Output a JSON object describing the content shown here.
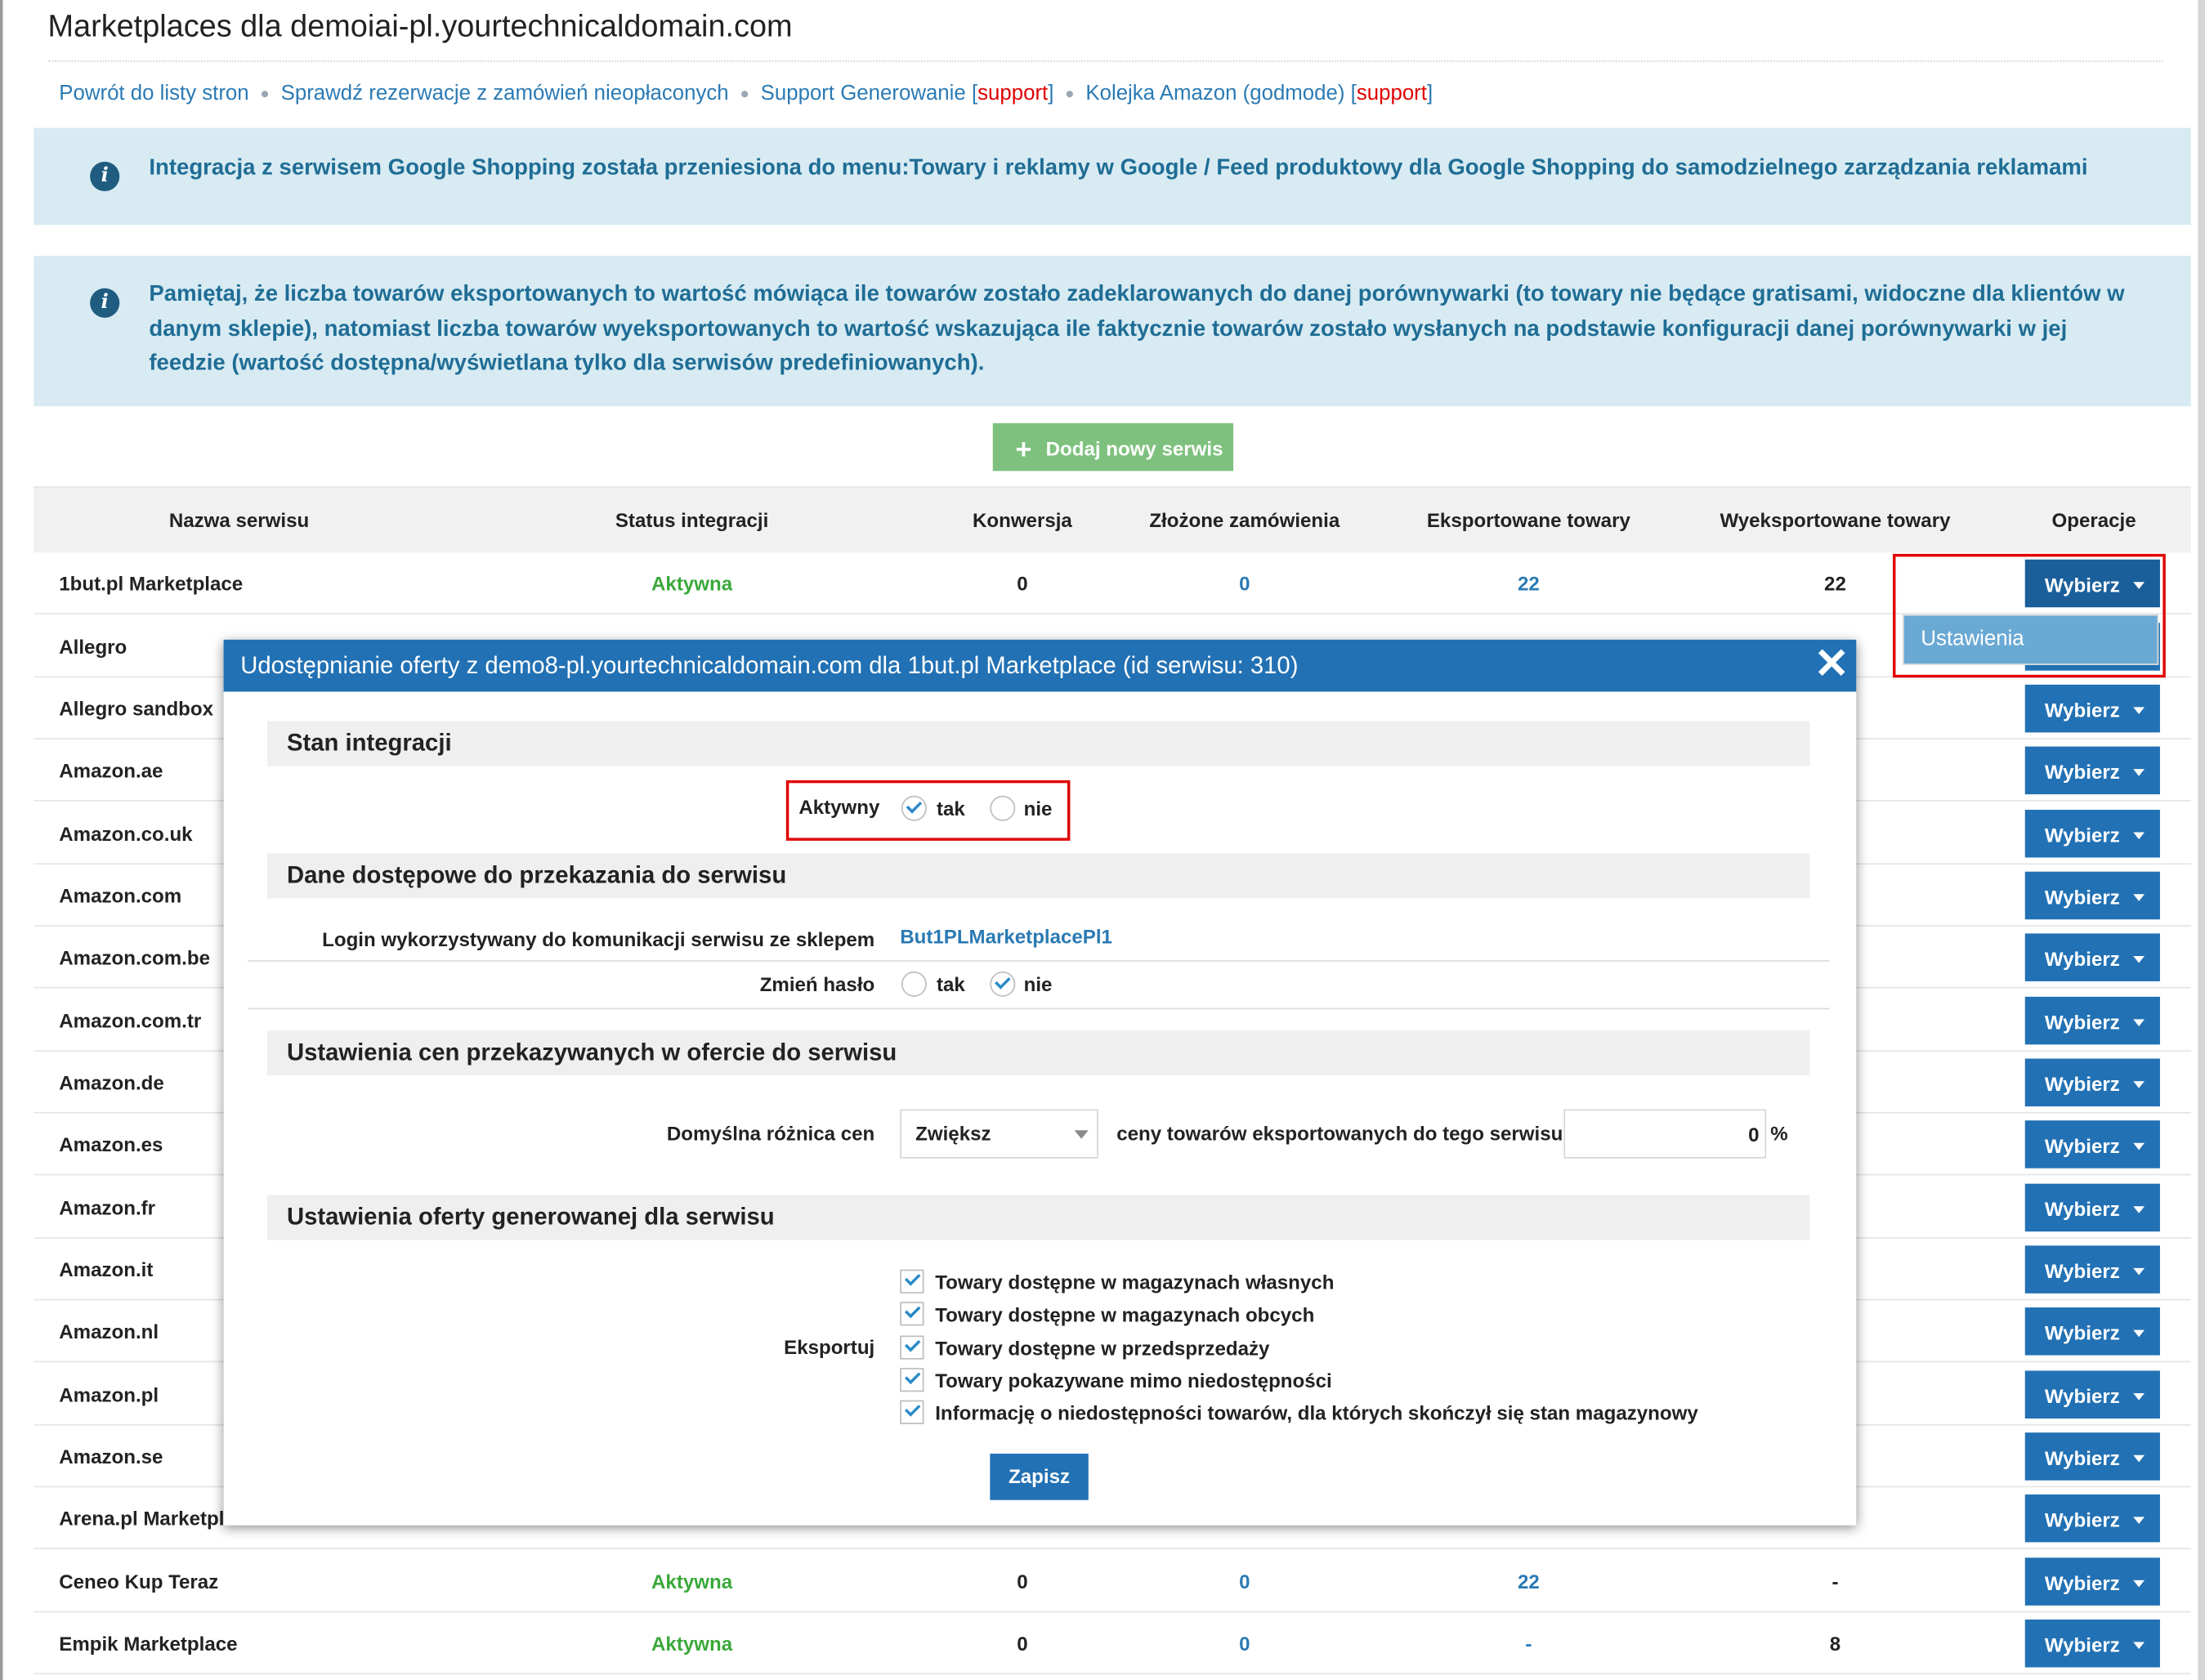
{
  "page": {
    "title": "Marketplaces dla demoiai-pl.yourtechnicaldomain.com"
  },
  "links": [
    {
      "label": "Powrót do listy stron"
    },
    {
      "label": "Sprawdź rezerwacje z zamówień nieopłaconych"
    },
    {
      "label": "Support Generowanie",
      "tag": "support"
    },
    {
      "label": "Kolejka Amazon (godmode)",
      "tag": "support"
    }
  ],
  "alerts": {
    "google": "Integracja z serwisem Google Shopping została przeniesiona do menu:Towary i reklamy w Google / Feed produktowy dla Google Shopping do samodzielnego zarządzania reklamami",
    "export": "Pamiętaj, że liczba towarów eksportowanych to wartość mówiąca ile towarów zostało zadeklarowanych do danej porównywarki (to towary nie będące gratisami, widoczne dla klientów w danym sklepie), natomiast liczba towarów wyeksportowanych to wartość wskazująca ile faktycznie towarów zostało wysłanych na podstawie konfiguracji danej porównywarki w jej feedzie (wartość dostępna/wyświetlana tylko dla serwisów predefiniowanych)."
  },
  "add_button": {
    "label": "Dodaj nowy serwis"
  },
  "table": {
    "headers": [
      "Nazwa serwisu",
      "Status integracji",
      "Konwersja",
      "Złożone zamówienia",
      "Eksportowane towary",
      "Wyeksportowane towary",
      "Operacje"
    ],
    "action_label": "Wybierz",
    "rows": [
      {
        "name": "1but.pl Marketplace",
        "status": "Aktywna",
        "conv": "0",
        "orders": "0",
        "exported": "22",
        "sent": "22"
      },
      {
        "name": "Allegro",
        "status": "",
        "conv": "",
        "orders": "",
        "exported": "",
        "sent": ""
      },
      {
        "name": "Allegro sandbox",
        "status": "",
        "conv": "",
        "orders": "",
        "exported": "",
        "sent": ""
      },
      {
        "name": "Amazon.ae",
        "status": "",
        "conv": "",
        "orders": "",
        "exported": "",
        "sent": ""
      },
      {
        "name": "Amazon.co.uk",
        "status": "",
        "conv": "",
        "orders": "",
        "exported": "",
        "sent": ""
      },
      {
        "name": "Amazon.com",
        "status": "",
        "conv": "",
        "orders": "",
        "exported": "",
        "sent": ""
      },
      {
        "name": "Amazon.com.be",
        "status": "",
        "conv": "",
        "orders": "",
        "exported": "",
        "sent": ""
      },
      {
        "name": "Amazon.com.tr",
        "status": "",
        "conv": "",
        "orders": "",
        "exported": "",
        "sent": ""
      },
      {
        "name": "Amazon.de",
        "status": "",
        "conv": "",
        "orders": "",
        "exported": "",
        "sent": ""
      },
      {
        "name": "Amazon.es",
        "status": "",
        "conv": "",
        "orders": "",
        "exported": "",
        "sent": ""
      },
      {
        "name": "Amazon.fr",
        "status": "",
        "conv": "",
        "orders": "",
        "exported": "",
        "sent": ""
      },
      {
        "name": "Amazon.it",
        "status": "",
        "conv": "",
        "orders": "",
        "exported": "",
        "sent": ""
      },
      {
        "name": "Amazon.nl",
        "status": "",
        "conv": "",
        "orders": "",
        "exported": "",
        "sent": ""
      },
      {
        "name": "Amazon.pl",
        "status": "",
        "conv": "",
        "orders": "",
        "exported": "",
        "sent": ""
      },
      {
        "name": "Amazon.se",
        "status": "",
        "conv": "",
        "orders": "",
        "exported": "",
        "sent": ""
      },
      {
        "name": "Arena.pl Marketplace",
        "status": "",
        "conv": "",
        "orders": "",
        "exported": "",
        "sent": ""
      },
      {
        "name": "Ceneo Kup Teraz",
        "status": "Aktywna",
        "conv": "0",
        "orders": "0",
        "exported": "22",
        "sent": "-"
      },
      {
        "name": "Empik Marketplace",
        "status": "Aktywna",
        "conv": "0",
        "orders": "0",
        "exported": "-",
        "sent": "8"
      }
    ]
  },
  "dropdown": {
    "item": "Ustawienia"
  },
  "modal": {
    "title": "Udostępnianie oferty z demo8-pl.yourtechnicaldomain.com dla 1but.pl Marketplace (id serwisu: 310)",
    "close": "✕",
    "sections": {
      "state": "Stan integracji",
      "access": "Dane dostępowe do przekazania do serwisu",
      "prices": "Ustawienia cen przekazywanych w ofercie do serwisu",
      "offer": "Ustawienia oferty generowanej dla serwisu"
    },
    "active": {
      "label": "Aktywny",
      "yes": "tak",
      "no": "nie",
      "value": "tak"
    },
    "login": {
      "label": "Login wykorzystywany do komunikacji serwisu ze sklepem",
      "value": "But1PLMarketplacePl1"
    },
    "change_password": {
      "label": "Zmień hasło",
      "yes": "tak",
      "no": "nie",
      "value": "nie"
    },
    "price": {
      "label": "Domyślna różnica cen",
      "mode": "Zwiększ",
      "text": "ceny towarów eksportowanych do tego serwisu o",
      "value": "0",
      "unit": "%"
    },
    "export": {
      "label": "Eksportuj",
      "options": [
        "Towary dostępne w magazynach własnych",
        "Towary dostępne w magazynach obcych",
        "Towary dostępne w przedsprzedaży",
        "Towary pokazywane mimo niedostępności",
        "Informację o niedostępności towarów, dla których skończył się stan magazynowy"
      ]
    },
    "save_label": "Zapisz"
  },
  "colors": {
    "accent": "#2271b4",
    "success": "#3aa83a",
    "alert_bg": "#d8ebf3",
    "highlight": "#e00000"
  }
}
